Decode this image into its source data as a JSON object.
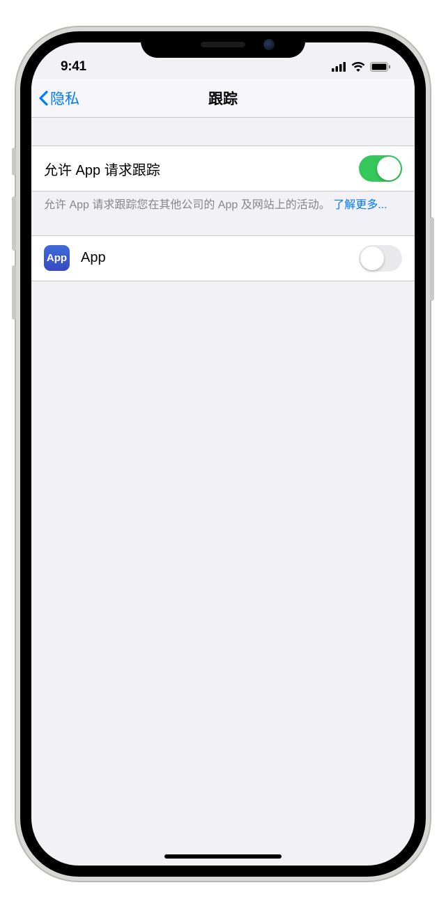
{
  "status": {
    "time": "9:41"
  },
  "nav": {
    "back_label": "隐私",
    "title": "跟踪"
  },
  "tracking": {
    "allow_requests_label": "允许 App 请求跟踪",
    "allow_requests_on": true,
    "footer_text": "允许 App 请求跟踪您在其他公司的 App 及网站上的活动。",
    "footer_link": "了解更多..."
  },
  "apps": [
    {
      "icon_label": "App",
      "name": "App",
      "enabled": false
    }
  ]
}
